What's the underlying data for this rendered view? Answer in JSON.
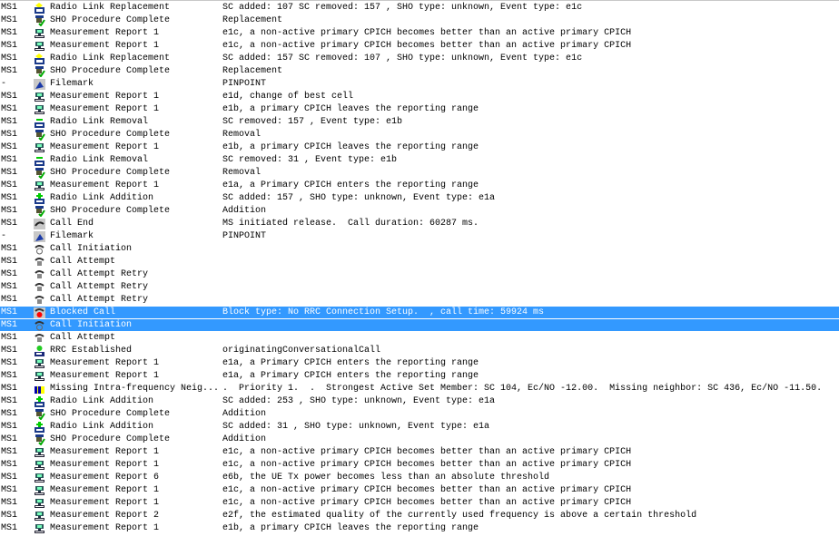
{
  "rows": [
    {
      "ms": "MS1",
      "icon": "radio-link-replacement-icon",
      "event": "Radio Link Replacement",
      "info": "SC added: 107 SC removed: 157 , SHO type: unknown, Event type: e1c"
    },
    {
      "ms": "MS1",
      "icon": "sho-complete-icon",
      "event": "SHO Procedure Complete",
      "info": "Replacement"
    },
    {
      "ms": "MS1",
      "icon": "measurement-report-icon",
      "event": "Measurement Report 1",
      "info": "e1c, a non-active primary CPICH becomes better than an active primary CPICH"
    },
    {
      "ms": "MS1",
      "icon": "measurement-report-icon",
      "event": "Measurement Report 1",
      "info": "e1c, a non-active primary CPICH becomes better than an active primary CPICH"
    },
    {
      "ms": "MS1",
      "icon": "radio-link-replacement-icon",
      "event": "Radio Link Replacement",
      "info": "SC added: 157 SC removed: 107 , SHO type: unknown, Event type: e1c"
    },
    {
      "ms": "MS1",
      "icon": "sho-complete-icon",
      "event": "SHO Procedure Complete",
      "info": "Replacement"
    },
    {
      "ms": "-",
      "icon": "filemark-icon",
      "event": "Filemark",
      "info": "PINPOINT"
    },
    {
      "ms": "MS1",
      "icon": "measurement-report-icon",
      "event": "Measurement Report 1",
      "info": "e1d, change of best cell"
    },
    {
      "ms": "MS1",
      "icon": "measurement-report-icon",
      "event": "Measurement Report 1",
      "info": "e1b, a primary CPICH leaves the reporting range"
    },
    {
      "ms": "MS1",
      "icon": "radio-link-removal-icon",
      "event": "Radio Link Removal",
      "info": "SC removed: 157 , Event type: e1b"
    },
    {
      "ms": "MS1",
      "icon": "sho-complete-icon",
      "event": "SHO Procedure Complete",
      "info": "Removal"
    },
    {
      "ms": "MS1",
      "icon": "measurement-report-icon",
      "event": "Measurement Report 1",
      "info": "e1b, a primary CPICH leaves the reporting range"
    },
    {
      "ms": "MS1",
      "icon": "radio-link-removal-icon",
      "event": "Radio Link Removal",
      "info": "SC removed: 31 , Event type: e1b"
    },
    {
      "ms": "MS1",
      "icon": "sho-complete-icon",
      "event": "SHO Procedure Complete",
      "info": "Removal"
    },
    {
      "ms": "MS1",
      "icon": "measurement-report-icon",
      "event": "Measurement Report 1",
      "info": "e1a, a Primary CPICH enters the reporting range"
    },
    {
      "ms": "MS1",
      "icon": "radio-link-addition-icon",
      "event": "Radio Link Addition",
      "info": "SC added: 157 , SHO type: unknown, Event type: e1a"
    },
    {
      "ms": "MS1",
      "icon": "sho-complete-icon",
      "event": "SHO Procedure Complete",
      "info": "Addition"
    },
    {
      "ms": "MS1",
      "icon": "call-end-icon",
      "event": "Call End",
      "info": "MS initiated release.  Call duration: 60287 ms."
    },
    {
      "ms": "-",
      "icon": "filemark-icon",
      "event": "Filemark",
      "info": "PINPOINT"
    },
    {
      "ms": "MS1",
      "icon": "call-initiation-icon",
      "event": "Call Initiation",
      "info": ""
    },
    {
      "ms": "MS1",
      "icon": "call-attempt-icon",
      "event": "Call Attempt",
      "info": ""
    },
    {
      "ms": "MS1",
      "icon": "call-attempt-icon",
      "event": "Call Attempt Retry",
      "info": ""
    },
    {
      "ms": "MS1",
      "icon": "call-attempt-icon",
      "event": "Call Attempt Retry",
      "info": ""
    },
    {
      "ms": "MS1",
      "icon": "call-attempt-icon",
      "event": "Call Attempt Retry",
      "info": ""
    },
    {
      "ms": "MS1",
      "icon": "blocked-call-icon",
      "event": "Blocked Call",
      "info": "Block type: No RRC Connection Setup.  , call time: 59924 ms",
      "selected": true
    },
    {
      "ms": "MS1",
      "icon": "call-initiation-icon",
      "event": "Call Initiation",
      "info": "",
      "selected": true
    },
    {
      "ms": "MS1",
      "icon": "call-attempt-icon",
      "event": "Call Attempt",
      "info": ""
    },
    {
      "ms": "MS1",
      "icon": "rrc-established-icon",
      "event": "RRC Established",
      "info": "originatingConversationalCall"
    },
    {
      "ms": "MS1",
      "icon": "measurement-report-icon",
      "event": "Measurement Report 1",
      "info": "e1a, a Primary CPICH enters the reporting range"
    },
    {
      "ms": "MS1",
      "icon": "measurement-report-icon",
      "event": "Measurement Report 1",
      "info": "e1a, a Primary CPICH enters the reporting range"
    },
    {
      "ms": "MS1",
      "icon": "missing-neighbor-icon",
      "event": "Missing Intra-frequency Neig...",
      "info": ".  Priority 1.  .  Strongest Active Set Member: SC 104, Ec/NO -12.00.  Missing neighbor: SC 436, Ec/NO -11.50."
    },
    {
      "ms": "MS1",
      "icon": "radio-link-addition-icon",
      "event": "Radio Link Addition",
      "info": "SC added: 253 , SHO type: unknown, Event type: e1a"
    },
    {
      "ms": "MS1",
      "icon": "sho-complete-icon",
      "event": "SHO Procedure Complete",
      "info": "Addition"
    },
    {
      "ms": "MS1",
      "icon": "radio-link-addition-icon",
      "event": "Radio Link Addition",
      "info": "SC added: 31 , SHO type: unknown, Event type: e1a"
    },
    {
      "ms": "MS1",
      "icon": "sho-complete-icon",
      "event": "SHO Procedure Complete",
      "info": "Addition"
    },
    {
      "ms": "MS1",
      "icon": "measurement-report-icon",
      "event": "Measurement Report 1",
      "info": "e1c, a non-active primary CPICH becomes better than an active primary CPICH"
    },
    {
      "ms": "MS1",
      "icon": "measurement-report-icon",
      "event": "Measurement Report 1",
      "info": "e1c, a non-active primary CPICH becomes better than an active primary CPICH"
    },
    {
      "ms": "MS1",
      "icon": "measurement-report-icon",
      "event": "Measurement Report 6",
      "info": "e6b, the UE Tx power becomes less than an absolute threshold"
    },
    {
      "ms": "MS1",
      "icon": "measurement-report-icon",
      "event": "Measurement Report 1",
      "info": "e1c, a non-active primary CPICH becomes better than an active primary CPICH"
    },
    {
      "ms": "MS1",
      "icon": "measurement-report-icon",
      "event": "Measurement Report 1",
      "info": "e1c, a non-active primary CPICH becomes better than an active primary CPICH"
    },
    {
      "ms": "MS1",
      "icon": "measurement-report-icon",
      "event": "Measurement Report 2",
      "info": "e2f, the estimated quality of the currently used frequency is above a certain threshold"
    },
    {
      "ms": "MS1",
      "icon": "measurement-report-icon",
      "event": "Measurement Report 1",
      "info": "e1b, a primary CPICH leaves the reporting range"
    }
  ],
  "colors": {
    "selection": "#3399ff"
  }
}
